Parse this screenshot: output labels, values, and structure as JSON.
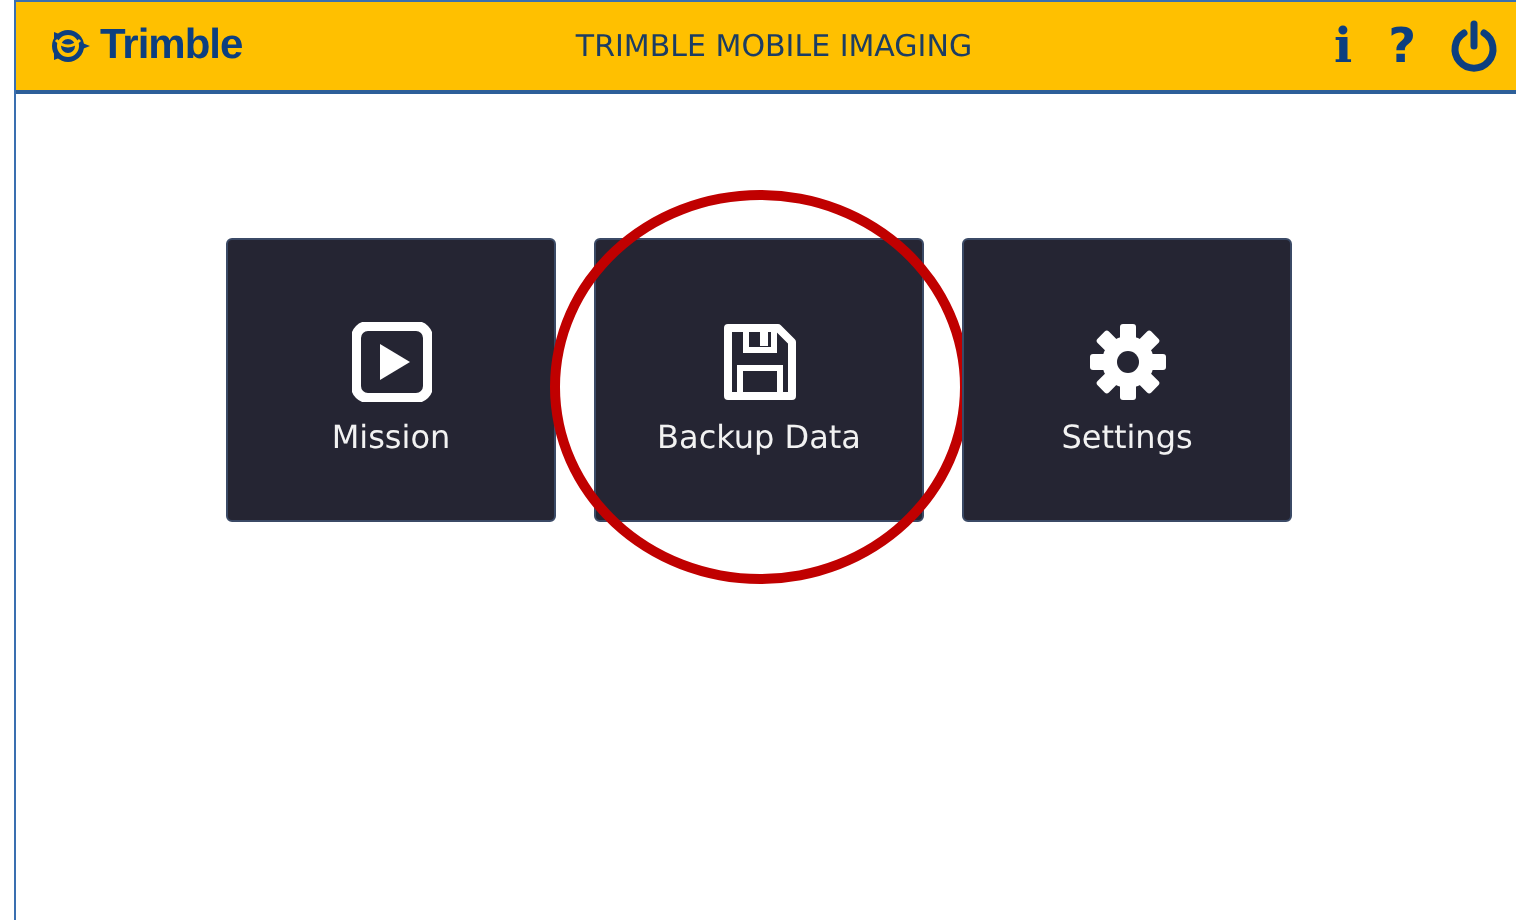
{
  "header": {
    "logo": "Trimble",
    "title": "TRIMBLE MOBILE IMAGING",
    "info_label": "i",
    "help_label": "?"
  },
  "tiles": [
    {
      "kind": "mission",
      "label": "Mission",
      "highlighted": false
    },
    {
      "kind": "backup",
      "label": "Backup Data",
      "highlighted": true
    },
    {
      "kind": "settings",
      "label": "Settings",
      "highlighted": false
    }
  ]
}
